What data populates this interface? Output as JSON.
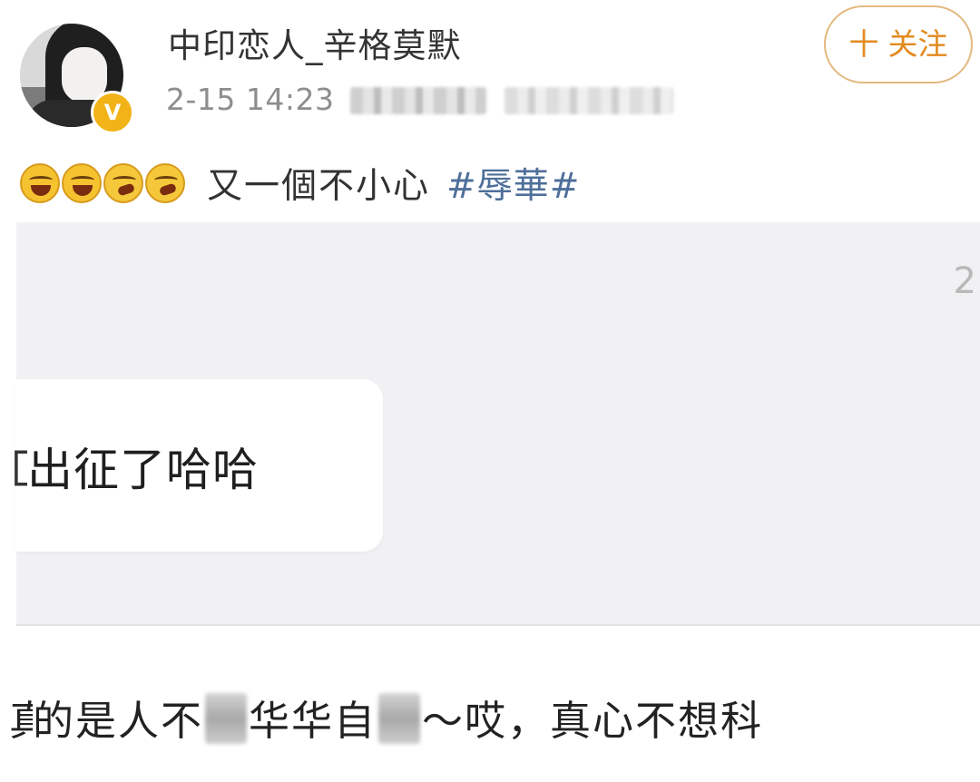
{
  "header": {
    "username": "中印恋人_辛格莫默",
    "time": "2-15 14:23",
    "verified_badge": "V",
    "follow_button": {
      "icon": "plus-icon",
      "plus_text": "十",
      "label": "关注"
    }
  },
  "post": {
    "emojis": [
      "laugh-cry-emoji",
      "laugh-cry-emoji",
      "crying-emoji",
      "crying-emoji"
    ],
    "text": "又一個不小心",
    "hashtag": "#辱華#"
  },
  "image": {
    "corner_number": "2",
    "chat_message": "出征了哈哈"
  },
  "bottom": {
    "text_part1": "真的是人不",
    "text_part2": "华华自",
    "text_part3": "～哎，真心不想科"
  },
  "colors": {
    "accent": "#e28a1e",
    "hashtag": "#4f6f9a",
    "badge": "#f2b318"
  }
}
